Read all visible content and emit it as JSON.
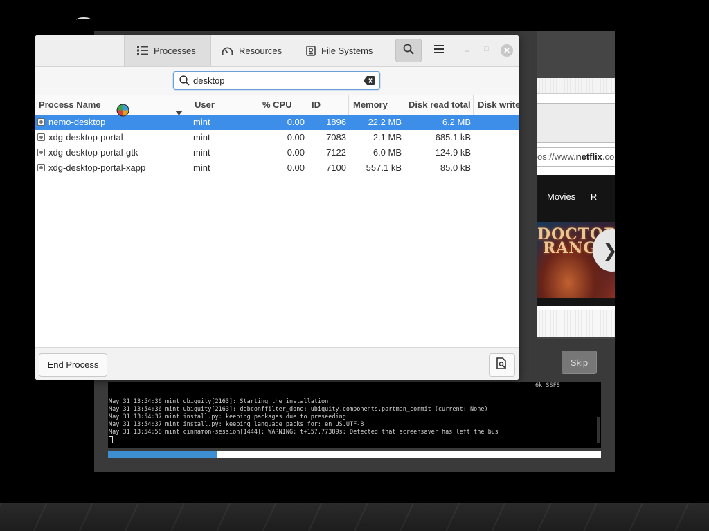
{
  "sysmon": {
    "tabs": [
      {
        "label": "Processes",
        "icon": "list-icon",
        "active": true
      },
      {
        "label": "Resources",
        "icon": "gauge-icon",
        "active": false
      },
      {
        "label": "File Systems",
        "icon": "disk-icon",
        "active": false
      }
    ],
    "search_value": "desktop",
    "columns": [
      "Process Name",
      "User",
      "% CPU",
      "ID",
      "Memory",
      "Disk read total",
      "Disk write"
    ],
    "rows": [
      {
        "name": "nemo-desktop",
        "user": "mint",
        "cpu": "0.00",
        "id": "1896",
        "memory": "22.2 MB",
        "disk_read": "6.2 MB",
        "selected": true
      },
      {
        "name": "xdg-desktop-portal",
        "user": "mint",
        "cpu": "0.00",
        "id": "7083",
        "memory": "2.1 MB",
        "disk_read": "685.1 kB",
        "selected": false
      },
      {
        "name": "xdg-desktop-portal-gtk",
        "user": "mint",
        "cpu": "0.00",
        "id": "7122",
        "memory": "6.0 MB",
        "disk_read": "124.9 kB",
        "selected": false
      },
      {
        "name": "xdg-desktop-portal-xapp",
        "user": "mint",
        "cpu": "0.00",
        "id": "7100",
        "memory": "557.1 kB",
        "disk_read": "85.0 kB",
        "selected": false
      }
    ],
    "end_process_label": "End Process",
    "window_controls": {
      "minimize": "–",
      "maximize": "□",
      "close": "✕"
    }
  },
  "installer": {
    "url_prefix": "os://www.",
    "url_bold": "netflix",
    "url_suffix": ".co",
    "menu_movies": "Movies",
    "menu_next": "R",
    "poster_line1": "DOCTOR",
    "poster_line2": "RANGE",
    "next_arrow": "❯",
    "skip_label": "Skip",
    "terminal_top": "6k SSFS",
    "terminal_lines": [
      "May 31 13:54:36 mint ubiquity[2163]: Starting the installation",
      "May 31 13:54:36 mint ubiquity[2163]: debconffilter_done: ubiquity.components.partman_commit (current: None)",
      "May 31 13:54:37 mint install.py: keeping packages due to preseeding:",
      "May 31 13:54:37 mint install.py: keeping language packs for: en_US.UTF-8",
      "May 31 13:54:58 mint cinnamon-session[1444]: WARNING: t+157.77389s: Detected that screensaver has left the bus"
    ],
    "progress": 0.22
  },
  "colors": {
    "accent": "#3d8ee8",
    "progress": "#3d8fd1"
  }
}
